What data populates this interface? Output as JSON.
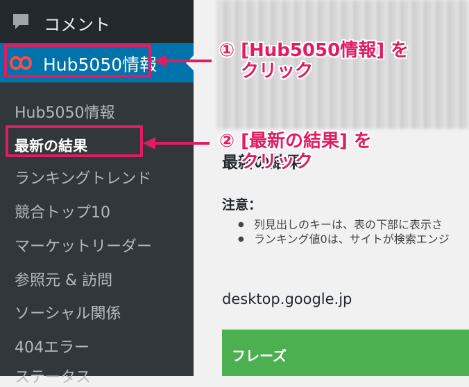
{
  "sidebar": {
    "comment_label": "コメント",
    "active_plugin_label": "Hub5050情報",
    "submenu": [
      "Hub5050情報",
      "最新の結果",
      "ランキングトレンド",
      "競合トップ10",
      "マーケットリーダー",
      "参照元 & 訪問",
      "ソーシャル関係",
      "404エラー",
      "ステータス"
    ],
    "current_index": 1
  },
  "main": {
    "page_title": "最新の結果",
    "notice_title": "注意：",
    "notes": [
      "列見出しのキーは、表の下部に表示さ",
      "ランキング値0は、サイトが検索エンジ"
    ],
    "domain": "desktop.google.jp",
    "table_header": "フレーズ"
  },
  "annotations": {
    "step1_line1": "① [Hub5050情報] を",
    "step1_line2": "クリック",
    "step2_line1": "② [最新の結果] を",
    "step2_line2": "クリック",
    "color": "#e01c64"
  },
  "colors": {
    "sidebar_bg": "#23282d",
    "submenu_bg": "#32373c",
    "active_bg": "#0073aa",
    "table_header_bg": "#4caf50"
  }
}
